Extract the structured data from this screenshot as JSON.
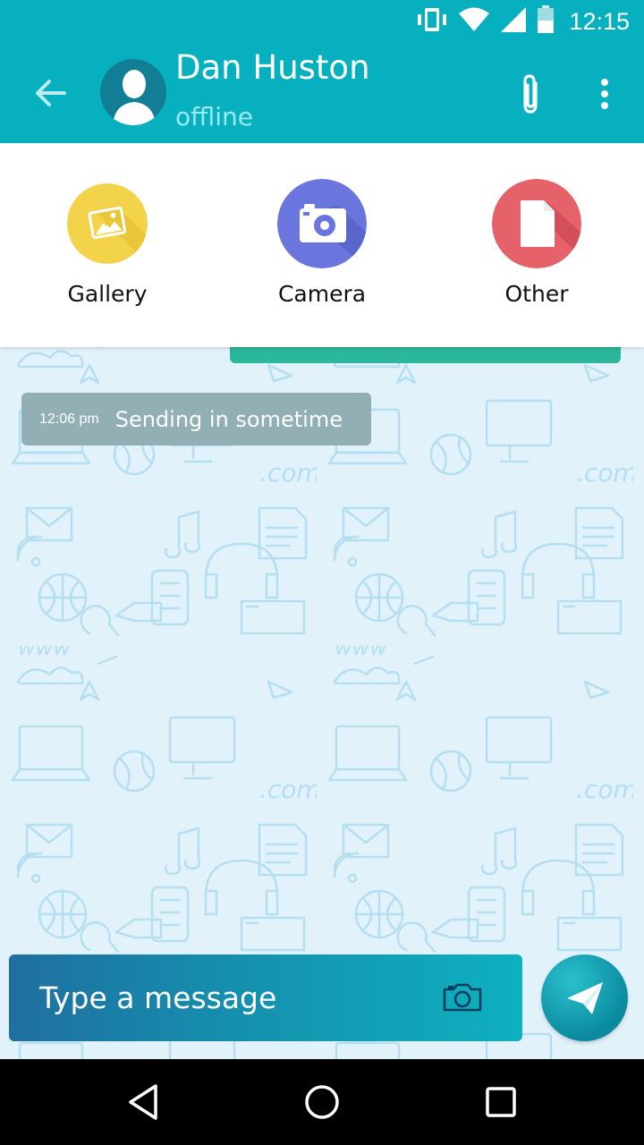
{
  "status_bar": {
    "time": "12:15",
    "icons": [
      "vibrate-icon",
      "wifi-icon",
      "signal-icon",
      "battery-icon"
    ]
  },
  "header": {
    "contact_name": "Dan Huston",
    "contact_status": "offline",
    "icons": [
      "back-arrow-icon",
      "avatar",
      "paperclip-icon",
      "more-vert-icon"
    ]
  },
  "attach_panel": {
    "options": [
      {
        "label": "Gallery",
        "icon": "gallery-icon",
        "color": "#f2d349"
      },
      {
        "label": "Camera",
        "icon": "camera-icon",
        "color": "#6a76dd"
      },
      {
        "label": "Other",
        "icon": "file-icon",
        "color": "#e6626b"
      }
    ]
  },
  "chat": {
    "messages": [
      {
        "time": "12:06 pm",
        "text": "Sending in sometime"
      }
    ]
  },
  "composer": {
    "placeholder": "Type a message",
    "icons": [
      "camera-icon",
      "send-icon"
    ]
  },
  "colors": {
    "primary": "#06b0bf",
    "chat_background": "#e2f2fb",
    "outgoing_bubble": "#2bb79c",
    "incoming_bubble": "#92afb6"
  },
  "nav_bar": {
    "icons": [
      "back-nav-icon",
      "home-nav-icon",
      "recents-nav-icon"
    ]
  }
}
